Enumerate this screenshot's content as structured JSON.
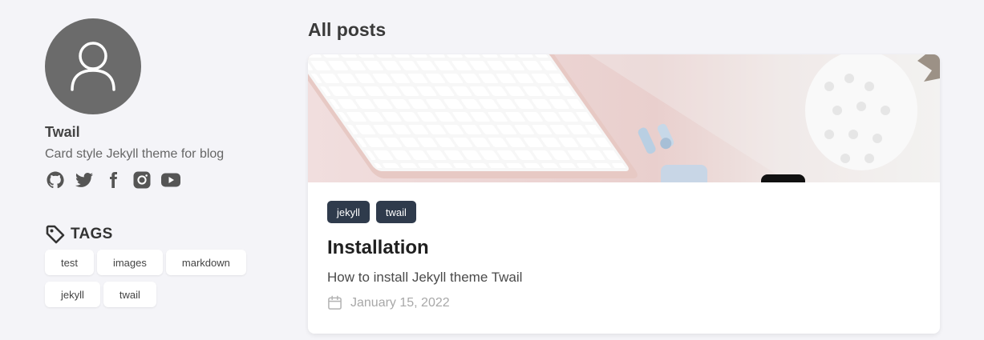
{
  "profile": {
    "name": "Twail",
    "description": "Card style Jekyll theme for blog",
    "socials": [
      "github-icon",
      "twitter-icon",
      "facebook-icon",
      "instagram-icon",
      "youtube-icon"
    ]
  },
  "tags": {
    "heading": "TAGS",
    "items": [
      {
        "label": "test"
      },
      {
        "label": "images"
      },
      {
        "label": "markdown"
      },
      {
        "label": "jekyll"
      },
      {
        "label": "twail"
      }
    ]
  },
  "main": {
    "section_title": "All posts",
    "posts": [
      {
        "tags": [
          {
            "label": "jekyll"
          },
          {
            "label": "twail"
          }
        ],
        "title": "Installation",
        "subtitle": "How to install Jekyll theme Twail",
        "date": "January 15, 2022"
      }
    ]
  },
  "colors": {
    "background": "#f4f4f8",
    "avatar": "#6b6b6b",
    "tag_dark": "#2f3b4c"
  }
}
